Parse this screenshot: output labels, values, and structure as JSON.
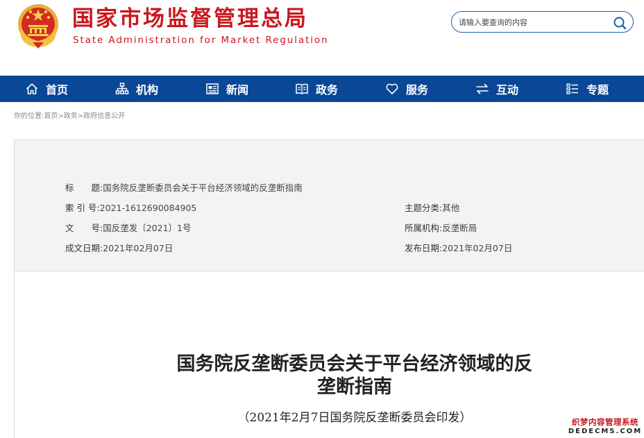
{
  "header": {
    "title": "国家市场监督管理总局",
    "subtitle": "State Administration for Market Regulation",
    "emblem_icon": "national-emblem-icon"
  },
  "search": {
    "placeholder": "请输入要查询的内容",
    "icon": "search-icon"
  },
  "nav": {
    "items": [
      {
        "label": "首页",
        "icon": "home-icon"
      },
      {
        "label": "机构",
        "icon": "org-chart-icon"
      },
      {
        "label": "新闻",
        "icon": "news-icon"
      },
      {
        "label": "政务",
        "icon": "government-book-icon"
      },
      {
        "label": "服务",
        "icon": "heart-icon"
      },
      {
        "label": "互动",
        "icon": "exchange-arrows-icon"
      },
      {
        "label": "专题",
        "icon": "topic-list-icon"
      }
    ]
  },
  "breadcrumb": {
    "prefix": "你的位置:",
    "items": [
      "首页",
      "政务",
      "政府信息公开"
    ],
    "separator": ">"
  },
  "info": {
    "title_label": "标　　题:",
    "title_value": "国务院反垄断委员会关于平台经济领域的反垄断指南",
    "index_label": "索 引 号:",
    "index_value": "2021-1612690084905",
    "topic_label": "主题分类:",
    "topic_value": "其他",
    "docno_label": "文　　号:",
    "docno_value": "国反垄发〔2021〕1号",
    "org_label": "所属机构:",
    "org_value": "反垄断局",
    "written_label": "成文日期:",
    "written_value": "2021年02月07日",
    "publish_label": "发布日期:",
    "publish_value": "2021年02月07日"
  },
  "article": {
    "title_line1": "国务院反垄断委员会关于平台经济领域的反",
    "title_line2": "垄断指南",
    "subtitle": "（2021年2月7日国务院反垄断委员会印发）"
  },
  "watermark": {
    "cn": "织梦内容管理系统",
    "en": "DEDECMS.COM"
  },
  "colors": {
    "brand_red": "#c9171e",
    "nav_blue": "#0a4797",
    "info_bg": "#f3f3f3"
  }
}
